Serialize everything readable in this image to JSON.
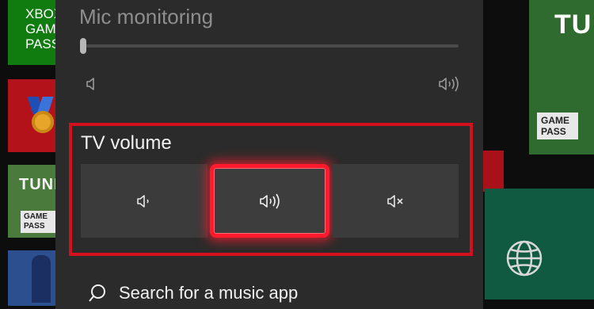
{
  "background_tiles": {
    "gamepass_tile": {
      "text": "XBOX GAME PASS"
    },
    "tunic_tile": {
      "title": "TUNI",
      "badge": "GAME PASS"
    },
    "right_tile": {
      "title": "TU",
      "badge": "GAME PASS"
    }
  },
  "panel": {
    "mic_monitoring": {
      "label": "Mic monitoring",
      "level_fraction": 0.0
    },
    "tv_volume": {
      "label": "TV volume",
      "options": [
        {
          "id": "low",
          "icon": "speaker-low-icon",
          "selected": false
        },
        {
          "id": "high",
          "icon": "speaker-high-icon",
          "selected": true
        },
        {
          "id": "mute",
          "icon": "speaker-mute-icon",
          "selected": false
        }
      ]
    },
    "search": {
      "label": "Search for a music app",
      "icon": "search-icon"
    }
  },
  "colors": {
    "panel_bg": "#2b2b2b",
    "highlight_red": "#d2101e",
    "focus_red": "#ff1a2e",
    "xbox_green": "#107c10"
  }
}
